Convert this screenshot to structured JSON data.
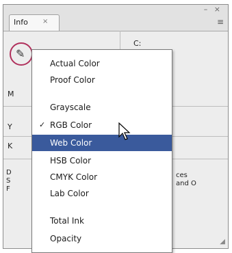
{
  "panel": {
    "tab_label": "Info",
    "tab_close": "×",
    "window_buttons": "– ×",
    "panel_menu_icon": "≡",
    "eyedropper_icon": "eyedropper-icon",
    "right_top_label": "C:",
    "row_labels": [
      "M",
      "Y",
      "K"
    ],
    "info_left": [
      "D",
      "S",
      "F"
    ],
    "info_right": [
      "ces",
      "and O"
    ]
  },
  "menu": {
    "items": [
      {
        "label": "Actual Color",
        "checked": false,
        "selected": false
      },
      {
        "label": "Proof Color",
        "checked": false,
        "selected": false
      },
      {
        "label": "Grayscale",
        "checked": false,
        "selected": false
      },
      {
        "label": "RGB Color",
        "checked": true,
        "selected": false
      },
      {
        "label": "Web Color",
        "checked": false,
        "selected": true
      },
      {
        "label": "HSB Color",
        "checked": false,
        "selected": false
      },
      {
        "label": "CMYK Color",
        "checked": false,
        "selected": false
      },
      {
        "label": "Lab Color",
        "checked": false,
        "selected": false
      },
      {
        "label": "Total Ink",
        "checked": false,
        "selected": false
      },
      {
        "label": "Opacity",
        "checked": false,
        "selected": false
      }
    ],
    "check_glyph": "✓"
  },
  "colors": {
    "selection": "#3a5a9c",
    "ring": "#b0305c"
  }
}
